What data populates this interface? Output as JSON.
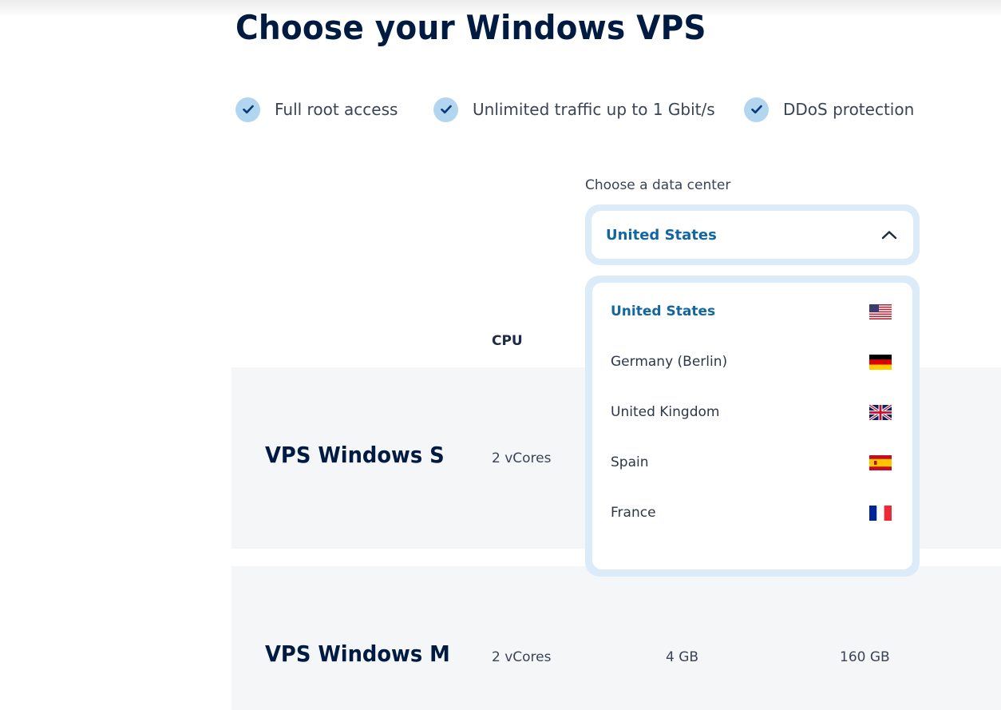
{
  "page": {
    "title": "Choose your Windows VPS"
  },
  "features": [
    {
      "icon": "check-icon",
      "label": "Full root access"
    },
    {
      "icon": "check-icon",
      "label": "Unlimited traffic up to 1 Gbit/s"
    },
    {
      "icon": "check-icon",
      "label": "DDoS protection"
    }
  ],
  "datacenter": {
    "label": "Choose a data center",
    "selected": "United States",
    "chevron_icon": "chevron-up-icon",
    "options": [
      {
        "label": "United States",
        "flag": "us-flag-icon",
        "selected": true
      },
      {
        "label": "Germany (Berlin)",
        "flag": "de-flag-icon",
        "selected": false
      },
      {
        "label": "United Kingdom",
        "flag": "gb-flag-icon",
        "selected": false
      },
      {
        "label": "Spain",
        "flag": "es-flag-icon",
        "selected": false
      },
      {
        "label": "France",
        "flag": "fr-flag-icon",
        "selected": false
      }
    ]
  },
  "table": {
    "headers": {
      "cpu": "CPU"
    },
    "rows": [
      {
        "name": "VPS Windows S",
        "cpu": "2 vCores",
        "ram": "",
        "ssd": ""
      },
      {
        "name": "VPS Windows M",
        "cpu": "2 vCores",
        "ram": "4 GB",
        "ssd": "160 GB"
      }
    ]
  },
  "colors": {
    "heading": "#001b41",
    "accent": "#14679e",
    "check_bg": "#b3d6f0",
    "dropdown_border": "#dcebf8",
    "row_bg": "#f4f6f8"
  }
}
